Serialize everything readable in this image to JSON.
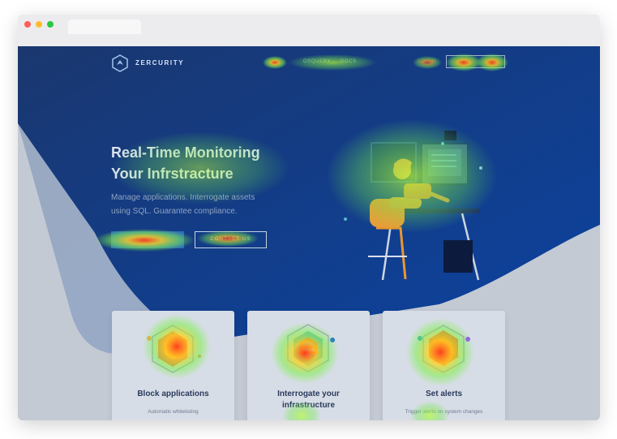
{
  "brand": {
    "name": "ZERCURITY"
  },
  "nav": {
    "items": [
      "OSQUERY",
      "DOCS",
      "LOGIN"
    ],
    "cta_label": ""
  },
  "hero": {
    "title_line1": "Real-Time Monitoring",
    "title_line2": "Your Infrstracture",
    "subtitle_line1": "Manage applications. Interrogate assets",
    "subtitle_line2": "using SQL. Guarantee compliance.",
    "primary_cta": "",
    "secondary_cta": "CONTACT US"
  },
  "features": [
    {
      "title": "Block applications",
      "description": "Automatic whitelisting"
    },
    {
      "title_line1": "Interrogate your",
      "title_line2": "infrastructure",
      "description": ""
    },
    {
      "title": "Set alerts",
      "description": "Trigger alerts on system changes"
    }
  ],
  "colors": {
    "hero_start": "#1a376f",
    "hero_end": "#0b43a2",
    "card": "#d7dde6",
    "title": "#d9e1ec",
    "heat_red": "#ff3b1f",
    "heat_yellow": "#ffd21f",
    "heat_green": "#7cf04a"
  }
}
